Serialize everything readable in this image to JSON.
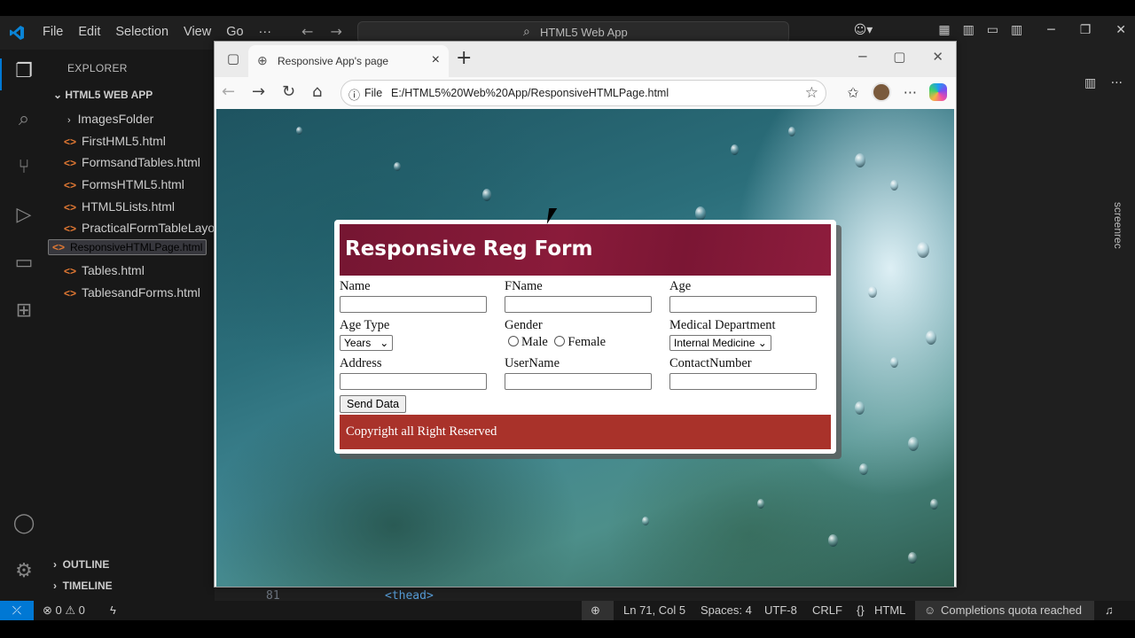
{
  "vscode": {
    "menu": [
      "File",
      "Edit",
      "Selection",
      "View",
      "Go",
      "···"
    ],
    "search_label": "HTML5 Web App",
    "explorer_title": "EXPLORER",
    "project_name": "HTML5 WEB APP",
    "files": [
      {
        "name": "ImagesFolder",
        "type": "folder"
      },
      {
        "name": "FirstHML5.html",
        "type": "file"
      },
      {
        "name": "FormsandTables.html",
        "type": "file"
      },
      {
        "name": "FormsHTML5.html",
        "type": "file"
      },
      {
        "name": "HTML5Lists.html",
        "type": "file"
      },
      {
        "name": "PracticalFormTableLayout.html",
        "type": "file"
      },
      {
        "name": "ResponsiveHTMLPage.html",
        "type": "file",
        "selected": true
      },
      {
        "name": "Tables.html",
        "type": "file"
      },
      {
        "name": "TablesandForms.html",
        "type": "file"
      }
    ],
    "outline_label": "OUTLINE",
    "timeline_label": "TIMELINE",
    "editor_line_number": "81",
    "editor_code": "<thead>",
    "screenrec_label": "screenrec",
    "status": {
      "errors": "0",
      "warnings": "0",
      "position": "Ln 71, Col 5",
      "spaces": "Spaces: 4",
      "encoding": "UTF-8",
      "eol": "CRLF",
      "language": "HTML",
      "copilot": "Completions quota reached"
    }
  },
  "browser": {
    "tab_title": "Responsive App's page",
    "url_scheme": "File",
    "url": "E:/HTML5%20Web%20App/ResponsiveHTMLPage.html",
    "page": {
      "form_title": "Responsive Reg Form",
      "labels": {
        "name": "Name",
        "fname": "FName",
        "age": "Age",
        "age_type": "Age Type",
        "gender": "Gender",
        "medical_department": "Medical Department",
        "address": "Address",
        "username": "UserName",
        "contact": "ContactNumber"
      },
      "age_type_selected": "Years",
      "gender_options": [
        "Male",
        "Female"
      ],
      "department_selected": "Internal Medicine",
      "submit_label": "Send Data",
      "footer": "Copyright all Right Reserved"
    }
  },
  "colors": {
    "vscode_accent": "#0078d4",
    "form_header": "#7f1836",
    "form_footer": "#a9322a"
  }
}
